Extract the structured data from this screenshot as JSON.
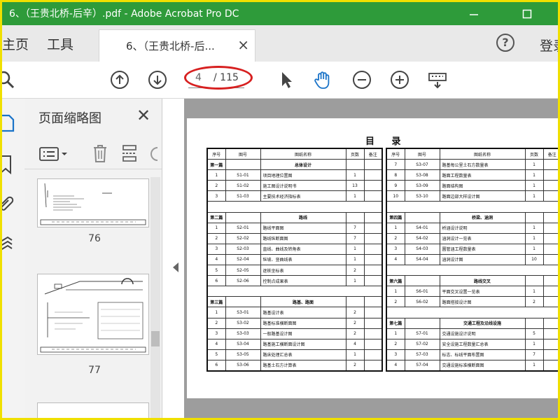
{
  "window": {
    "title": "6、（王贵北桥-后辛）.pdf - Adobe Acrobat Pro DC"
  },
  "nav": {
    "home": "主页",
    "tools": "工具",
    "doc_tab": "6、（王贵北桥-后...",
    "login": "登录"
  },
  "toolbar": {
    "current_page": "4",
    "total_pages": "/ 115"
  },
  "panel": {
    "title": "页面缩略图",
    "thumb_labels": [
      "76",
      "77"
    ]
  },
  "document": {
    "title": "目 录",
    "headers": [
      "序号",
      "图号",
      "图纸名称",
      "页数",
      "备注"
    ],
    "left_rows": [
      {
        "type": "sec",
        "num": "第一篇",
        "name": "总体设计"
      },
      {
        "num": "1",
        "code": "S1-01",
        "name": "项目地理位置图",
        "pages": "1"
      },
      {
        "num": "2",
        "code": "S1-02",
        "name": "施工图设计说明书",
        "pages": "13"
      },
      {
        "num": "3",
        "code": "S1-03",
        "name": "主要技术经济指标表",
        "pages": "1"
      },
      {
        "type": "blank"
      },
      {
        "type": "sec",
        "num": "第二篇",
        "name": "路线"
      },
      {
        "num": "1",
        "code": "S2-01",
        "name": "路线平面图",
        "pages": "7"
      },
      {
        "num": "2",
        "code": "S2-02",
        "name": "路线纵断面图",
        "pages": "7"
      },
      {
        "num": "3",
        "code": "S2-03",
        "name": "直线、曲线及转角表",
        "pages": "1"
      },
      {
        "num": "4",
        "code": "S2-04",
        "name": "纵坡、竖曲线表",
        "pages": "1"
      },
      {
        "num": "5",
        "code": "S2-05",
        "name": "逐桩坐标表",
        "pages": "2"
      },
      {
        "num": "6",
        "code": "S2-06",
        "name": "控制点成果表",
        "pages": "1"
      },
      {
        "type": "blank"
      },
      {
        "type": "sec",
        "num": "第三篇",
        "name": "路基、路面"
      },
      {
        "num": "1",
        "code": "S3-01",
        "name": "路基设计表",
        "pages": "2"
      },
      {
        "num": "2",
        "code": "S3-02",
        "name": "路基标准横断面图",
        "pages": "2"
      },
      {
        "num": "3",
        "code": "S3-03",
        "name": "一般路基设计图",
        "pages": "2"
      },
      {
        "num": "4",
        "code": "S3-04",
        "name": "路基施工横断面设计图",
        "pages": "4"
      },
      {
        "num": "5",
        "code": "S3-05",
        "name": "路床处理汇总表",
        "pages": "1"
      },
      {
        "num": "6",
        "code": "S3-06",
        "name": "路基土石方计算表",
        "pages": "2"
      }
    ],
    "right_rows": [
      {
        "num": "7",
        "code": "S3-07",
        "name": "路基每公里土石方数量表",
        "pages": "1"
      },
      {
        "num": "8",
        "code": "S3-08",
        "name": "路面工程数量表",
        "pages": "1"
      },
      {
        "num": "9",
        "code": "S3-09",
        "name": "路面结构图",
        "pages": "1"
      },
      {
        "num": "10",
        "code": "S3-10",
        "name": "路面边部大样设计图",
        "pages": "1"
      },
      {
        "type": "blank"
      },
      {
        "type": "sec",
        "num": "第四篇",
        "name": "桥梁、涵洞"
      },
      {
        "num": "1",
        "code": "S4-01",
        "name": "桥涵设计说明",
        "pages": "1"
      },
      {
        "num": "2",
        "code": "S4-02",
        "name": "涵洞设计一览表",
        "pages": "1"
      },
      {
        "num": "3",
        "code": "S4-03",
        "name": "圆管涵工程数量表",
        "pages": "1"
      },
      {
        "num": "4",
        "code": "S4-04",
        "name": "涵洞设计图",
        "pages": "10"
      },
      {
        "type": "blank"
      },
      {
        "type": "sec",
        "num": "第六篇",
        "name": "路线交叉"
      },
      {
        "num": "1",
        "code": "S6-01",
        "name": "平面交叉设置一览表",
        "pages": "1"
      },
      {
        "num": "2",
        "code": "S6-02",
        "name": "路面搭接设计图",
        "pages": "2"
      },
      {
        "type": "blank"
      },
      {
        "type": "sec",
        "num": "第七篇",
        "name": "交通工程及沿线设施"
      },
      {
        "num": "1",
        "code": "S7-01",
        "name": "交通设施设计说明",
        "pages": "5"
      },
      {
        "num": "2",
        "code": "S7-02",
        "name": "安全设施工程数量汇总表",
        "pages": "1"
      },
      {
        "num": "3",
        "code": "S7-03",
        "name": "标志、标线平面布置图",
        "pages": "7"
      },
      {
        "num": "4",
        "code": "S7-04",
        "name": "交通设施标准横断面图",
        "pages": "1"
      }
    ]
  }
}
